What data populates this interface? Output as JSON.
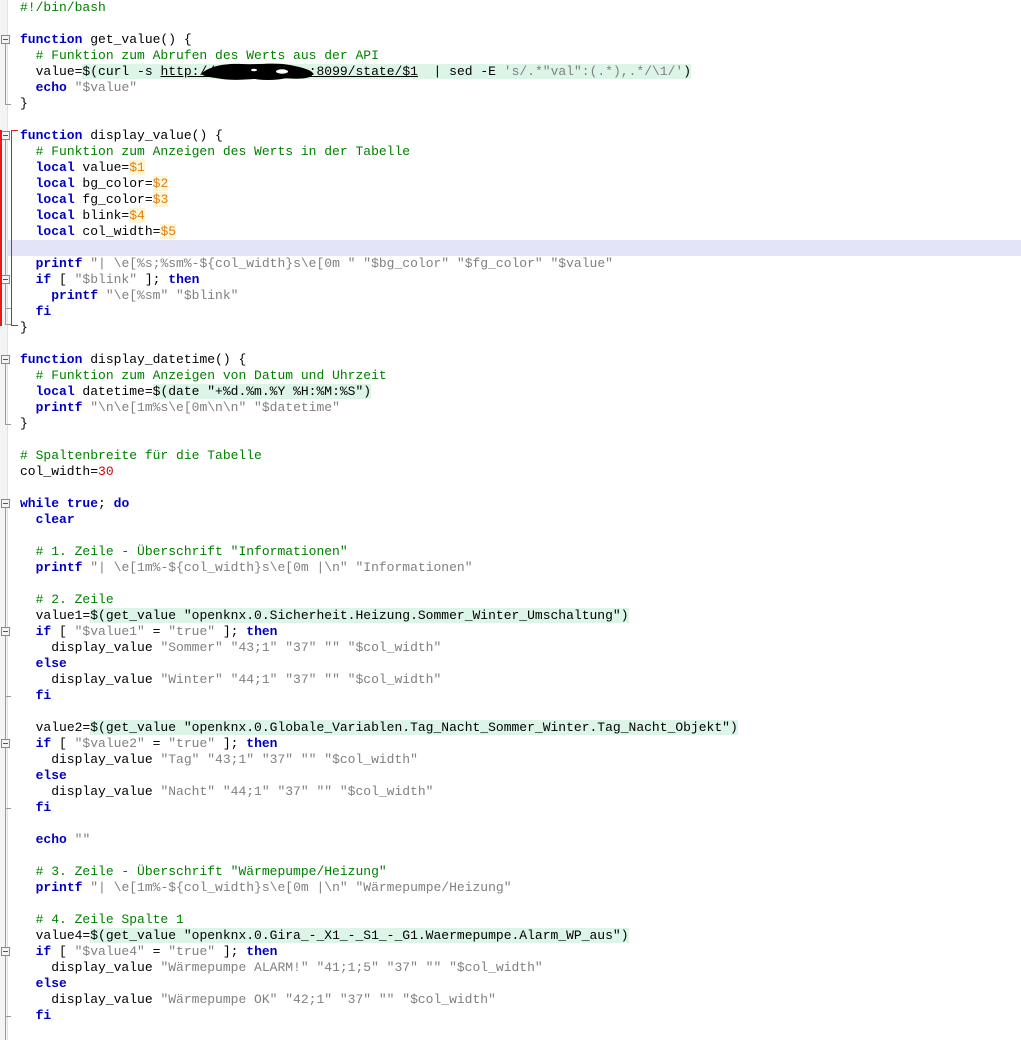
{
  "editor": {
    "language": "bash",
    "colors": {
      "keyword": "#0000c0",
      "comment": "#008000",
      "string": "#808080",
      "number": "#d40000",
      "variable": "#e08010",
      "variable_highlight": "#fbf6d8",
      "substitution_highlight": "#ddf5e6",
      "current_line": "#e4e4f8",
      "scope_bracket": "#e21b1b",
      "gutter": "#f4f4f4",
      "background": "#ffffff",
      "foreground": "#000000"
    },
    "current_line_number": 16,
    "redaction_label": "redacted-ip-address"
  },
  "code_lines": [
    {
      "n": 1,
      "text": "#!/bin/bash",
      "tokens": [
        {
          "t": "#!/bin/bash",
          "c": "cm"
        }
      ]
    },
    {
      "n": 2,
      "text": "",
      "tokens": []
    },
    {
      "n": 3,
      "text": "function get_value() {",
      "tokens": [
        {
          "t": "function",
          "c": "kw"
        },
        {
          "t": " get_value() {",
          "c": "plain"
        }
      ]
    },
    {
      "n": 4,
      "text": "  # Funktion zum Abrufen des Werts aus der API",
      "tokens": [
        {
          "t": "  ",
          "c": "plain"
        },
        {
          "t": "# Funktion zum Abrufen des Werts aus der API",
          "c": "cm"
        }
      ]
    },
    {
      "n": 5,
      "text": "  value=$(curl -s http://REDACTED:8099/state/$1  | sed -E 's/.*\"val\":(.*),.*/\\1/')",
      "tokens": []
    },
    {
      "n": 6,
      "text": "  echo \"$value\"",
      "tokens": [
        {
          "t": "  ",
          "c": "plain"
        },
        {
          "t": "echo",
          "c": "kw"
        },
        {
          "t": " ",
          "c": "plain"
        },
        {
          "t": "\"$value\"",
          "c": "str"
        }
      ]
    },
    {
      "n": 7,
      "text": "}",
      "tokens": [
        {
          "t": "}",
          "c": "plain"
        }
      ]
    },
    {
      "n": 8,
      "text": "",
      "tokens": []
    },
    {
      "n": 9,
      "text": "function display_value() {",
      "tokens": [
        {
          "t": "function",
          "c": "kw"
        },
        {
          "t": " display_value() {",
          "c": "plain"
        }
      ]
    },
    {
      "n": 10,
      "text": "  # Funktion zum Anzeigen des Werts in der Tabelle",
      "tokens": [
        {
          "t": "  ",
          "c": "plain"
        },
        {
          "t": "# Funktion zum Anzeigen des Werts in der Tabelle",
          "c": "cm"
        }
      ]
    },
    {
      "n": 11,
      "text": "  local value=$1",
      "tokens": [
        {
          "t": "  ",
          "c": "plain"
        },
        {
          "t": "local",
          "c": "kw"
        },
        {
          "t": " value=",
          "c": "plain"
        },
        {
          "t": "$1",
          "c": "var"
        }
      ]
    },
    {
      "n": 12,
      "text": "  local bg_color=$2",
      "tokens": [
        {
          "t": "  ",
          "c": "plain"
        },
        {
          "t": "local",
          "c": "kw"
        },
        {
          "t": " bg_color=",
          "c": "plain"
        },
        {
          "t": "$2",
          "c": "var"
        }
      ]
    },
    {
      "n": 13,
      "text": "  local fg_color=$3",
      "tokens": [
        {
          "t": "  ",
          "c": "plain"
        },
        {
          "t": "local",
          "c": "kw"
        },
        {
          "t": " fg_color=",
          "c": "plain"
        },
        {
          "t": "$3",
          "c": "var"
        }
      ]
    },
    {
      "n": 14,
      "text": "  local blink=$4",
      "tokens": [
        {
          "t": "  ",
          "c": "plain"
        },
        {
          "t": "local",
          "c": "kw"
        },
        {
          "t": " blink=",
          "c": "plain"
        },
        {
          "t": "$4",
          "c": "var"
        }
      ]
    },
    {
      "n": 15,
      "text": "  local col_width=$5",
      "tokens": [
        {
          "t": "  ",
          "c": "plain"
        },
        {
          "t": "local",
          "c": "kw"
        },
        {
          "t": " col_width=",
          "c": "plain"
        },
        {
          "t": "$5",
          "c": "var"
        }
      ]
    },
    {
      "n": 16,
      "text": "",
      "tokens": [],
      "current": true
    },
    {
      "n": 17,
      "text": "  printf \"| \\e[%s;%sm%-${col_width}s\\e[0m \" \"$bg_color\" \"$fg_color\" \"$value\"",
      "tokens": [
        {
          "t": "  ",
          "c": "plain"
        },
        {
          "t": "printf",
          "c": "kw"
        },
        {
          "t": " ",
          "c": "plain"
        },
        {
          "t": "\"| \\e[%s;%sm%-${col_width}s\\e[0m \" \"$bg_color\" \"$fg_color\" \"$value\"",
          "c": "str"
        }
      ]
    },
    {
      "n": 18,
      "text": "  if [ \"$blink\" ]; then",
      "tokens": [
        {
          "t": "  ",
          "c": "plain"
        },
        {
          "t": "if",
          "c": "kw"
        },
        {
          "t": " [ ",
          "c": "plain"
        },
        {
          "t": "\"$blink\"",
          "c": "str"
        },
        {
          "t": " ]; ",
          "c": "plain"
        },
        {
          "t": "then",
          "c": "kw"
        }
      ]
    },
    {
      "n": 19,
      "text": "    printf \"\\e[%sm\" \"$blink\"",
      "tokens": [
        {
          "t": "    ",
          "c": "plain"
        },
        {
          "t": "printf",
          "c": "kw"
        },
        {
          "t": " ",
          "c": "plain"
        },
        {
          "t": "\"\\e[%sm\" \"$blink\"",
          "c": "str"
        }
      ]
    },
    {
      "n": 20,
      "text": "  fi",
      "tokens": [
        {
          "t": "  ",
          "c": "plain"
        },
        {
          "t": "fi",
          "c": "kw"
        }
      ]
    },
    {
      "n": 21,
      "text": "}",
      "tokens": [
        {
          "t": "}",
          "c": "plain"
        }
      ]
    },
    {
      "n": 22,
      "text": "",
      "tokens": []
    },
    {
      "n": 23,
      "text": "function display_datetime() {",
      "tokens": [
        {
          "t": "function",
          "c": "kw"
        },
        {
          "t": " display_datetime() {",
          "c": "plain"
        }
      ]
    },
    {
      "n": 24,
      "text": "  # Funktion zum Anzeigen von Datum und Uhrzeit",
      "tokens": [
        {
          "t": "  ",
          "c": "plain"
        },
        {
          "t": "# Funktion zum Anzeigen von Datum und Uhrzeit",
          "c": "cm"
        }
      ]
    },
    {
      "n": 25,
      "text": "  local datetime=$(date \"+%d.%m.%Y %H:%M:%S\")",
      "tokens": []
    },
    {
      "n": 26,
      "text": "  printf \"\\n\\e[1m%s\\e[0m\\n\\n\" \"$datetime\"",
      "tokens": [
        {
          "t": "  ",
          "c": "plain"
        },
        {
          "t": "printf",
          "c": "kw"
        },
        {
          "t": " ",
          "c": "plain"
        },
        {
          "t": "\"\\n\\e[1m%s\\e[0m\\n\\n\" \"$datetime\"",
          "c": "str"
        }
      ]
    },
    {
      "n": 27,
      "text": "}",
      "tokens": [
        {
          "t": "}",
          "c": "plain"
        }
      ]
    },
    {
      "n": 28,
      "text": "",
      "tokens": []
    },
    {
      "n": 29,
      "text": "# Spaltenbreite für die Tabelle",
      "tokens": [
        {
          "t": "# Spaltenbreite für die Tabelle",
          "c": "cm"
        }
      ]
    },
    {
      "n": 30,
      "text": "col_width=30",
      "tokens": [
        {
          "t": "col_width=",
          "c": "plain"
        },
        {
          "t": "30",
          "c": "num"
        }
      ]
    },
    {
      "n": 31,
      "text": "",
      "tokens": []
    },
    {
      "n": 32,
      "text": "while true; do",
      "tokens": [
        {
          "t": "while",
          "c": "kw"
        },
        {
          "t": " ",
          "c": "plain"
        },
        {
          "t": "true",
          "c": "kw"
        },
        {
          "t": "; ",
          "c": "plain"
        },
        {
          "t": "do",
          "c": "kw"
        }
      ]
    },
    {
      "n": 33,
      "text": "  clear",
      "tokens": [
        {
          "t": "  ",
          "c": "plain"
        },
        {
          "t": "clear",
          "c": "kw"
        }
      ]
    },
    {
      "n": 34,
      "text": "",
      "tokens": []
    },
    {
      "n": 35,
      "text": "  # 1. Zeile - Überschrift \"Informationen\"",
      "tokens": [
        {
          "t": "  ",
          "c": "plain"
        },
        {
          "t": "# 1. Zeile - Überschrift \"Informationen\"",
          "c": "cm"
        }
      ]
    },
    {
      "n": 36,
      "text": "  printf \"| \\e[1m%-${col_width}s\\e[0m |\\n\" \"Informationen\"",
      "tokens": [
        {
          "t": "  ",
          "c": "plain"
        },
        {
          "t": "printf",
          "c": "kw"
        },
        {
          "t": " ",
          "c": "plain"
        },
        {
          "t": "\"| \\e[1m%-${col_width}s\\e[0m |\\n\" \"Informationen\"",
          "c": "str"
        }
      ]
    },
    {
      "n": 37,
      "text": "",
      "tokens": []
    },
    {
      "n": 38,
      "text": "  # 2. Zeile",
      "tokens": [
        {
          "t": "  ",
          "c": "plain"
        },
        {
          "t": "# 2. Zeile",
          "c": "cm"
        }
      ]
    },
    {
      "n": 39,
      "text": "  value1=$(get_value \"openknx.0.Sicherheit.Heizung.Sommer_Winter_Umschaltung\")",
      "tokens": []
    },
    {
      "n": 40,
      "text": "  if [ \"$value1\" = \"true\" ]; then",
      "tokens": [
        {
          "t": "  ",
          "c": "plain"
        },
        {
          "t": "if",
          "c": "kw"
        },
        {
          "t": " [ ",
          "c": "plain"
        },
        {
          "t": "\"$value1\"",
          "c": "str"
        },
        {
          "t": " = ",
          "c": "plain"
        },
        {
          "t": "\"true\"",
          "c": "str"
        },
        {
          "t": " ]; ",
          "c": "plain"
        },
        {
          "t": "then",
          "c": "kw"
        }
      ]
    },
    {
      "n": 41,
      "text": "    display_value \"Sommer\" \"43;1\" \"37\" \"\" \"$col_width\"",
      "tokens": [
        {
          "t": "    display_value ",
          "c": "plain"
        },
        {
          "t": "\"Sommer\" \"43;1\" \"37\" \"\" \"$col_width\"",
          "c": "str"
        }
      ]
    },
    {
      "n": 42,
      "text": "  else",
      "tokens": [
        {
          "t": "  ",
          "c": "plain"
        },
        {
          "t": "else",
          "c": "kw"
        }
      ]
    },
    {
      "n": 43,
      "text": "    display_value \"Winter\" \"44;1\" \"37\" \"\" \"$col_width\"",
      "tokens": [
        {
          "t": "    display_value ",
          "c": "plain"
        },
        {
          "t": "\"Winter\" \"44;1\" \"37\" \"\" \"$col_width\"",
          "c": "str"
        }
      ]
    },
    {
      "n": 44,
      "text": "  fi",
      "tokens": [
        {
          "t": "  ",
          "c": "plain"
        },
        {
          "t": "fi",
          "c": "kw"
        }
      ]
    },
    {
      "n": 45,
      "text": "",
      "tokens": []
    },
    {
      "n": 46,
      "text": "  value2=$(get_value \"openknx.0.Globale_Variablen.Tag_Nacht_Sommer_Winter.Tag_Nacht_Objekt\")",
      "tokens": []
    },
    {
      "n": 47,
      "text": "  if [ \"$value2\" = \"true\" ]; then",
      "tokens": [
        {
          "t": "  ",
          "c": "plain"
        },
        {
          "t": "if",
          "c": "kw"
        },
        {
          "t": " [ ",
          "c": "plain"
        },
        {
          "t": "\"$value2\"",
          "c": "str"
        },
        {
          "t": " = ",
          "c": "plain"
        },
        {
          "t": "\"true\"",
          "c": "str"
        },
        {
          "t": " ]; ",
          "c": "plain"
        },
        {
          "t": "then",
          "c": "kw"
        }
      ]
    },
    {
      "n": 48,
      "text": "    display_value \"Tag\" \"43;1\" \"37\" \"\" \"$col_width\"",
      "tokens": [
        {
          "t": "    display_value ",
          "c": "plain"
        },
        {
          "t": "\"Tag\" \"43;1\" \"37\" \"\" \"$col_width\"",
          "c": "str"
        }
      ]
    },
    {
      "n": 49,
      "text": "  else",
      "tokens": [
        {
          "t": "  ",
          "c": "plain"
        },
        {
          "t": "else",
          "c": "kw"
        }
      ]
    },
    {
      "n": 50,
      "text": "    display_value \"Nacht\" \"44;1\" \"37\" \"\" \"$col_width\"",
      "tokens": [
        {
          "t": "    display_value ",
          "c": "plain"
        },
        {
          "t": "\"Nacht\" \"44;1\" \"37\" \"\" \"$col_width\"",
          "c": "str"
        }
      ]
    },
    {
      "n": 51,
      "text": "  fi",
      "tokens": [
        {
          "t": "  ",
          "c": "plain"
        },
        {
          "t": "fi",
          "c": "kw"
        }
      ]
    },
    {
      "n": 52,
      "text": "",
      "tokens": []
    },
    {
      "n": 53,
      "text": "  echo \"\"",
      "tokens": [
        {
          "t": "  ",
          "c": "plain"
        },
        {
          "t": "echo",
          "c": "kw"
        },
        {
          "t": " ",
          "c": "plain"
        },
        {
          "t": "\"\"",
          "c": "str"
        }
      ]
    },
    {
      "n": 54,
      "text": "",
      "tokens": []
    },
    {
      "n": 55,
      "text": "  # 3. Zeile - Überschrift \"Wärmepumpe/Heizung\"",
      "tokens": [
        {
          "t": "  ",
          "c": "plain"
        },
        {
          "t": "# 3. Zeile - Überschrift \"Wärmepumpe/Heizung\"",
          "c": "cm"
        }
      ]
    },
    {
      "n": 56,
      "text": "  printf \"| \\e[1m%-${col_width}s\\e[0m |\\n\" \"Wärmepumpe/Heizung\"",
      "tokens": [
        {
          "t": "  ",
          "c": "plain"
        },
        {
          "t": "printf",
          "c": "kw"
        },
        {
          "t": " ",
          "c": "plain"
        },
        {
          "t": "\"| \\e[1m%-${col_width}s\\e[0m |\\n\" \"Wärmepumpe/Heizung\"",
          "c": "str"
        }
      ]
    },
    {
      "n": 57,
      "text": "",
      "tokens": []
    },
    {
      "n": 58,
      "text": "  # 4. Zeile Spalte 1",
      "tokens": [
        {
          "t": "  ",
          "c": "plain"
        },
        {
          "t": "# 4. Zeile Spalte 1",
          "c": "cm"
        }
      ]
    },
    {
      "n": 59,
      "text": "  value4=$(get_value \"openknx.0.Gira_-_X1_-_S1_-_G1.Waermepumpe.Alarm_WP_aus\")",
      "tokens": []
    },
    {
      "n": 60,
      "text": "  if [ \"$value4\" = \"true\" ]; then",
      "tokens": [
        {
          "t": "  ",
          "c": "plain"
        },
        {
          "t": "if",
          "c": "kw"
        },
        {
          "t": " [ ",
          "c": "plain"
        },
        {
          "t": "\"$value4\"",
          "c": "str"
        },
        {
          "t": " = ",
          "c": "plain"
        },
        {
          "t": "\"true\"",
          "c": "str"
        },
        {
          "t": " ]; ",
          "c": "plain"
        },
        {
          "t": "then",
          "c": "kw"
        }
      ]
    },
    {
      "n": 61,
      "text": "    display_value \"Wärmepumpe ALARM!\" \"41;1;5\" \"37\" \"\" \"$col_width\"",
      "tokens": [
        {
          "t": "    display_value ",
          "c": "plain"
        },
        {
          "t": "\"Wärmepumpe ALARM!\" \"41;1;5\" \"37\" \"\" \"$col_width\"",
          "c": "str"
        }
      ]
    },
    {
      "n": 62,
      "text": "  else",
      "tokens": [
        {
          "t": "  ",
          "c": "plain"
        },
        {
          "t": "else",
          "c": "kw"
        }
      ]
    },
    {
      "n": 63,
      "text": "    display_value \"Wärmepumpe OK\" \"42;1\" \"37\" \"\" \"$col_width\"",
      "tokens": [
        {
          "t": "    display_value ",
          "c": "plain"
        },
        {
          "t": "\"Wärmepumpe OK\" \"42;1\" \"37\" \"\" \"$col_width\"",
          "c": "str"
        }
      ]
    },
    {
      "n": 64,
      "text": "  fi",
      "tokens": [
        {
          "t": "  ",
          "c": "plain"
        },
        {
          "t": "fi",
          "c": "kw"
        }
      ]
    },
    {
      "n": 65,
      "text": "",
      "tokens": []
    }
  ],
  "special_lines": {
    "curl": {
      "indent": "  ",
      "lhs": "value=",
      "subst_open": "$(",
      "cmd": "curl",
      "flag": " -s ",
      "url_prefix": "http://",
      "url_redacted": "REDACTED",
      "url_suffix": ":8099/state/",
      "url_param": "$1",
      "pipe": "  | sed -E ",
      "sed_expr": "'s/.*\"val\":(.*),.*/\\1/'",
      "subst_close": ")"
    },
    "datetime": {
      "indent": "  ",
      "kw": "local",
      "lhs": " datetime=",
      "subst": "$(date \"+%d.%m.%Y %H:%M:%S\")"
    },
    "value1": {
      "indent": "  ",
      "lhs": "value1=",
      "subst_open": "$(",
      "fn": "get_value ",
      "arg": "\"openknx.0.Sicherheit.Heizung.Sommer_Winter_Umschaltung\"",
      "subst_close": ")"
    },
    "value2": {
      "indent": "  ",
      "lhs": "value2=",
      "subst_open": "$(",
      "fn": "get_value ",
      "arg": "\"openknx.0.Globale_Variablen.Tag_Nacht_Sommer_Winter.Tag_Nacht_Objekt\"",
      "subst_close": ")"
    },
    "value4": {
      "indent": "  ",
      "lhs": "value4=",
      "subst_open": "$(",
      "fn": "get_value ",
      "arg": "\"openknx.0.Gira_-_X1_-_S1_-_G1.Waermepumpe.Alarm_WP_aus\"",
      "subst_close": ")"
    }
  }
}
